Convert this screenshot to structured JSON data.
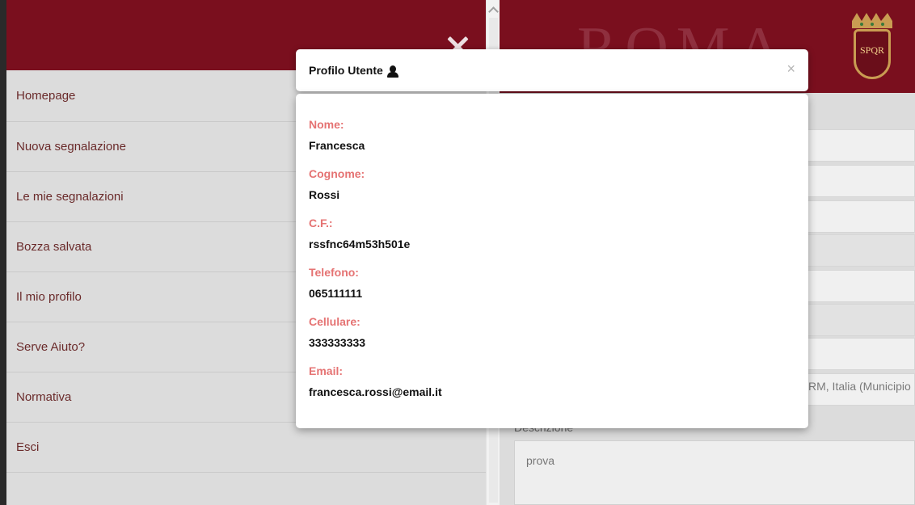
{
  "sidebar": {
    "items": [
      {
        "label": "Homepage"
      },
      {
        "label": "Nuova segnalazione"
      },
      {
        "label": "Le mie segnalazioni"
      },
      {
        "label": "Bozza salvata"
      },
      {
        "label": "Il mio profilo"
      },
      {
        "label": "Serve Aiuto?"
      },
      {
        "label": "Normativa"
      },
      {
        "label": "Esci"
      }
    ]
  },
  "header": {
    "logo_text": "ROMA",
    "crest_text": "SPQR"
  },
  "form": {
    "address_value": "RM, Italia (Municipio",
    "description_label": "Descrizione",
    "description_value": "prova"
  },
  "modal": {
    "title": "Profilo Utente",
    "close_symbol": "×",
    "fields": [
      {
        "label": "Nome:",
        "value": "Francesca"
      },
      {
        "label": "Cognome:",
        "value": "Rossi"
      },
      {
        "label": "C.F.:",
        "value": "rssfnc64m53h501e"
      },
      {
        "label": "Telefono:",
        "value": "065111111"
      },
      {
        "label": "Cellulare:",
        "value": "333333333"
      },
      {
        "label": "Email:",
        "value": "francesca.rossi@email.it"
      }
    ]
  },
  "colors": {
    "brand": "#7a0f1e",
    "label_accent": "#e57373"
  }
}
